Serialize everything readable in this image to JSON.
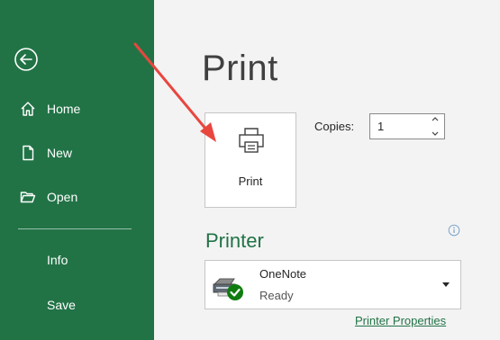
{
  "sidebar": {
    "items": [
      {
        "label": "Home",
        "icon": "home-icon"
      },
      {
        "label": "New",
        "icon": "new-document-icon"
      },
      {
        "label": "Open",
        "icon": "open-folder-icon"
      },
      {
        "label": "Info"
      },
      {
        "label": "Save"
      }
    ]
  },
  "main": {
    "title": "Print",
    "print_button_label": "Print",
    "copies_label": "Copies:",
    "copies_value": "1",
    "printer_heading": "Printer",
    "printer": {
      "name": "OneNote",
      "status": "Ready"
    },
    "printer_properties_link": "Printer Properties"
  },
  "colors": {
    "accent": "#217346",
    "annotation_arrow": "#e8463f"
  }
}
